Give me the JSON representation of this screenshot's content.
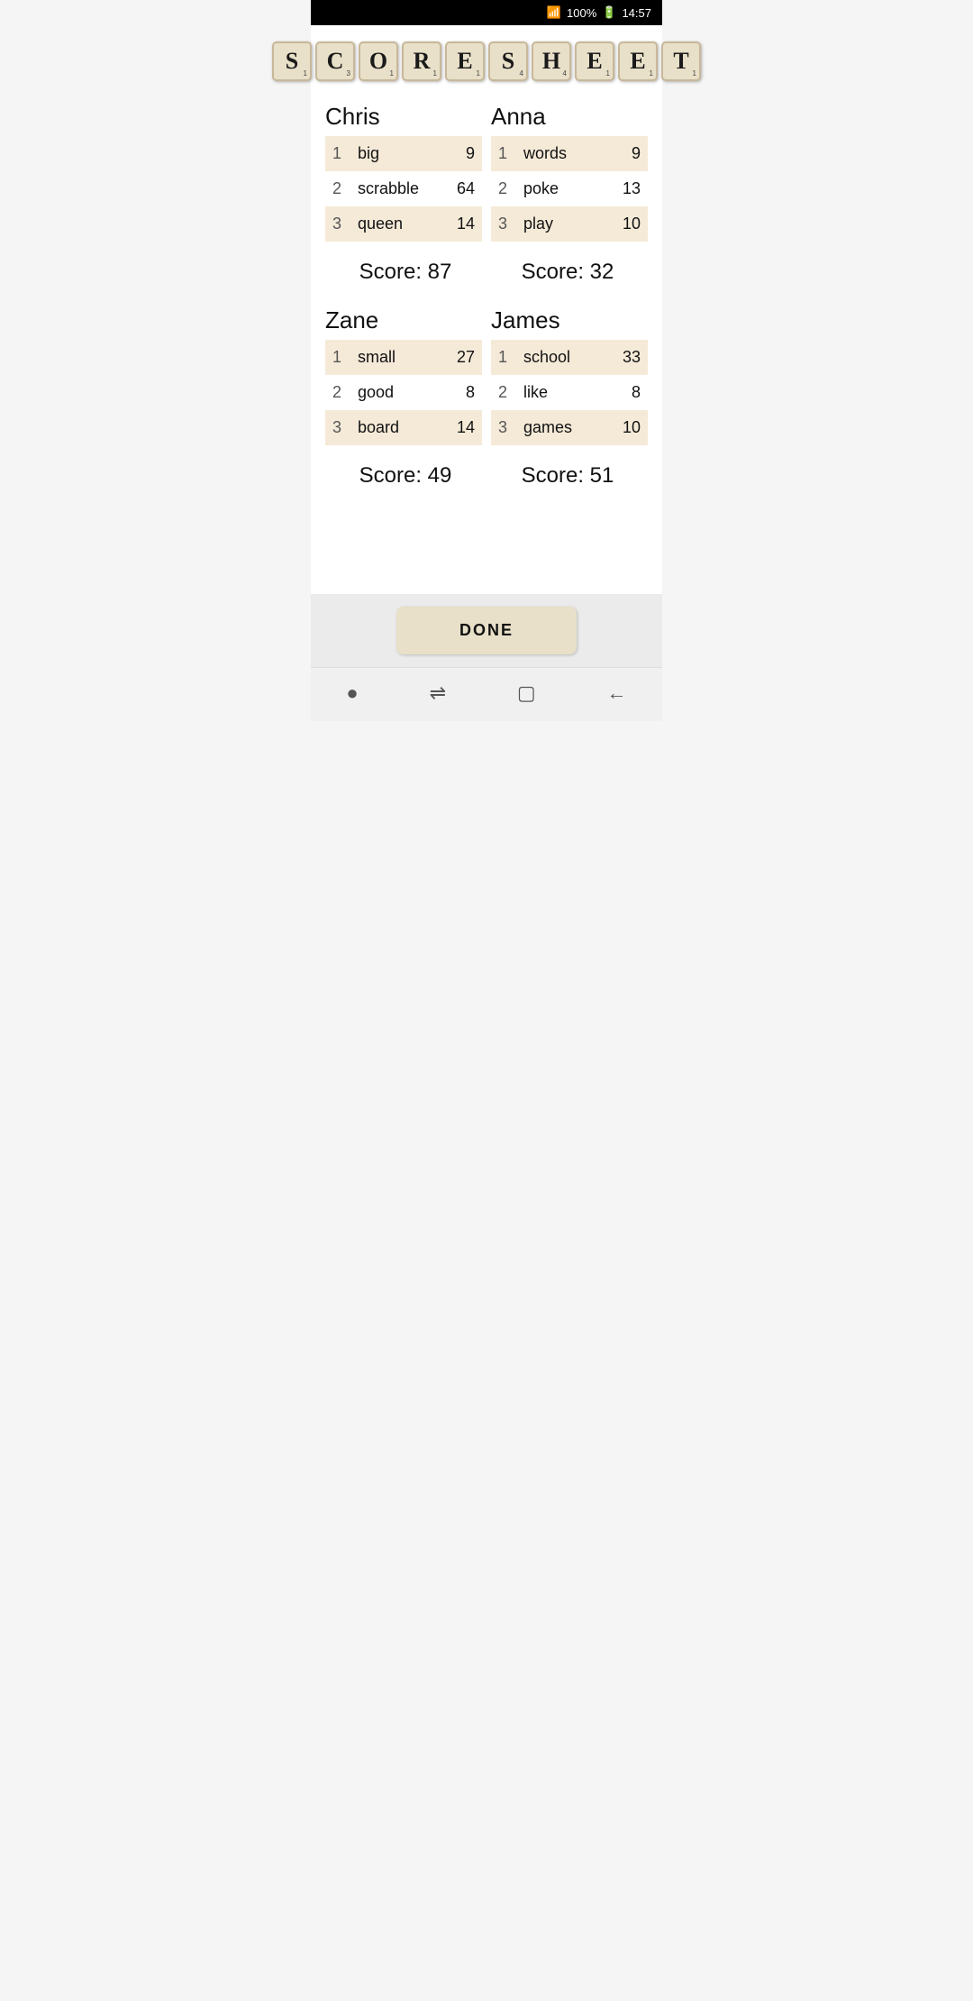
{
  "statusBar": {
    "signal": "▲",
    "battery": "100%",
    "batteryIcon": "🔋",
    "time": "14:57"
  },
  "title": {
    "letters": [
      {
        "char": "S",
        "num": "1"
      },
      {
        "char": "C",
        "num": "3"
      },
      {
        "char": "O",
        "num": "1"
      },
      {
        "char": "R",
        "num": "1"
      },
      {
        "char": "E",
        "num": "1"
      },
      {
        "char": "S",
        "num": "4"
      },
      {
        "char": "H",
        "num": "4"
      },
      {
        "char": "E",
        "num": "1"
      },
      {
        "char": "E",
        "num": "1"
      },
      {
        "char": "T",
        "num": "1"
      }
    ]
  },
  "players": [
    {
      "name": "Chris",
      "words": [
        {
          "num": 1,
          "word": "big",
          "score": 9
        },
        {
          "num": 2,
          "word": "scrabble",
          "score": 64
        },
        {
          "num": 3,
          "word": "queen",
          "score": 14
        }
      ],
      "total": "Score: 87"
    },
    {
      "name": "Anna",
      "words": [
        {
          "num": 1,
          "word": "words",
          "score": 9
        },
        {
          "num": 2,
          "word": "poke",
          "score": 13
        },
        {
          "num": 3,
          "word": "play",
          "score": 10
        }
      ],
      "total": "Score: 32"
    },
    {
      "name": "Zane",
      "words": [
        {
          "num": 1,
          "word": "small",
          "score": 27
        },
        {
          "num": 2,
          "word": "good",
          "score": 8
        },
        {
          "num": 3,
          "word": "board",
          "score": 14
        }
      ],
      "total": "Score: 49"
    },
    {
      "name": "James",
      "words": [
        {
          "num": 1,
          "word": "school",
          "score": 33
        },
        {
          "num": 2,
          "word": "like",
          "score": 8
        },
        {
          "num": 3,
          "word": "games",
          "score": 10
        }
      ],
      "total": "Score: 51"
    }
  ],
  "doneButton": "DONE",
  "nav": {
    "home": "●",
    "menu": "⇌",
    "square": "□",
    "back": "←"
  }
}
